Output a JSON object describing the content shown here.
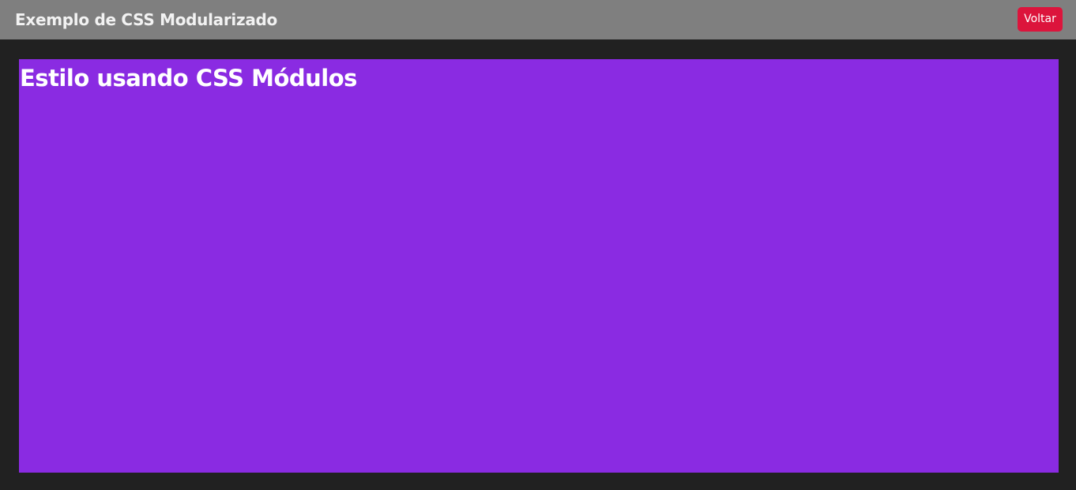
{
  "header": {
    "title": "Exemplo de CSS Modularizado",
    "back_label": "Voltar"
  },
  "main": {
    "heading": "Estilo usando CSS Módulos"
  },
  "colors": {
    "page_background": "#212121",
    "header_background": "#7f7f7f",
    "back_button": "#dc143c",
    "panel_background": "#8a2be2",
    "text": "#ffffff"
  }
}
